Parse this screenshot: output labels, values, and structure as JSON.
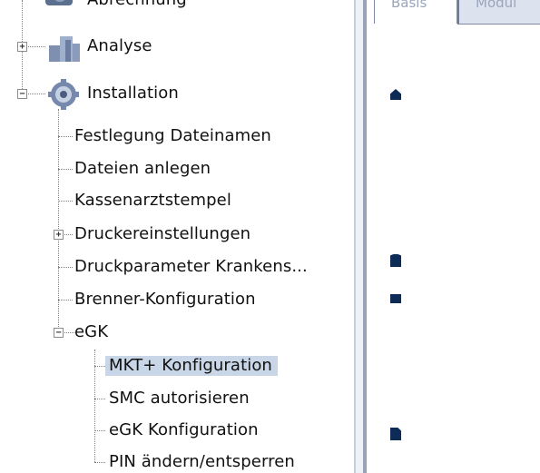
{
  "tree": {
    "items": [
      {
        "id": "abrechnung",
        "label": "Abrechnung"
      },
      {
        "id": "analyse",
        "label": "Analyse"
      },
      {
        "id": "installation",
        "label": "Installation"
      },
      {
        "id": "festlegung",
        "label": "Festlegung Dateinamen"
      },
      {
        "id": "dateien",
        "label": "Dateien anlegen"
      },
      {
        "id": "kassenarzt",
        "label": "Kassenarztstempel"
      },
      {
        "id": "druckereinst",
        "label": "Druckereinstellungen"
      },
      {
        "id": "druckparam",
        "label": "Druckparameter Krankens..."
      },
      {
        "id": "brenner",
        "label": "Brenner-Konfiguration"
      },
      {
        "id": "egk",
        "label": "eGK"
      },
      {
        "id": "mkt",
        "label": "MKT+ Konfiguration"
      },
      {
        "id": "smc",
        "label": "SMC autorisieren"
      },
      {
        "id": "egkkonf",
        "label": "eGK Konfiguration"
      },
      {
        "id": "pin",
        "label": "PIN ändern/entsperren"
      }
    ],
    "selected": "MKT+ Konfiguration"
  },
  "tabs": [
    {
      "label": "Basis",
      "active": true
    },
    {
      "label": "Modul",
      "active": false
    }
  ],
  "icons": [
    "folder-gear-icon",
    "analyse-icon",
    "gear-icon",
    "house-icon",
    "shirt-icon",
    "card-icon",
    "document-icon"
  ],
  "colors": {
    "selection": "#c9d6e7",
    "glyph": "#0c2c57"
  }
}
